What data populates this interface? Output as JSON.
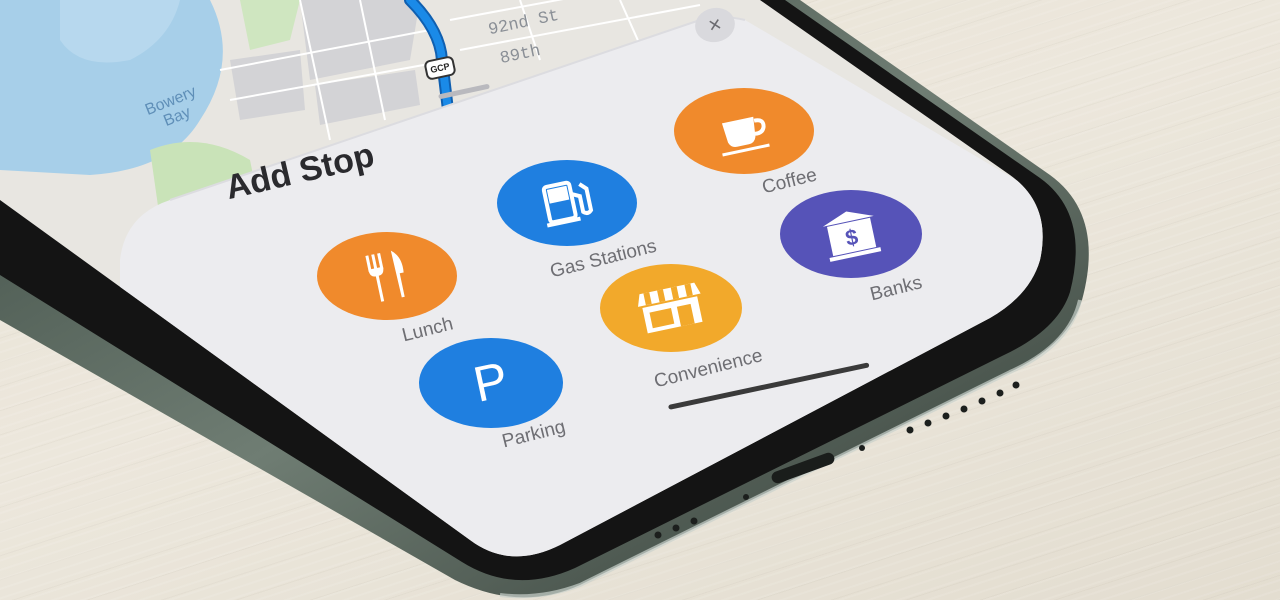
{
  "map": {
    "street_labels": [
      "92nd St",
      "89th"
    ],
    "water_label": "Bowery Bay",
    "route_shield": "GCP"
  },
  "sheet": {
    "title": "Add Stop",
    "close_label": "×"
  },
  "stops": [
    {
      "label": "Gas Stations",
      "icon": "gas-pump-icon",
      "color": "#1f7fe0"
    },
    {
      "label": "Coffee",
      "icon": "coffee-cup-icon",
      "color": "#f08a2c"
    },
    {
      "label": "Lunch",
      "icon": "fork-knife-icon",
      "color": "#f08a2c"
    },
    {
      "label": "Banks",
      "icon": "bank-dollar-icon",
      "color": "#5653b8"
    },
    {
      "label": "Convenience",
      "icon": "storefront-icon",
      "color": "#f2a92b"
    },
    {
      "label": "Parking",
      "icon": "parking-p-icon",
      "color": "#1f7fe0"
    }
  ],
  "colors": {
    "sheet_background": "#ececef",
    "route_blue": "#1a8ae8",
    "map_water": "#a7cfe9",
    "map_land": "#e8e6e1"
  }
}
